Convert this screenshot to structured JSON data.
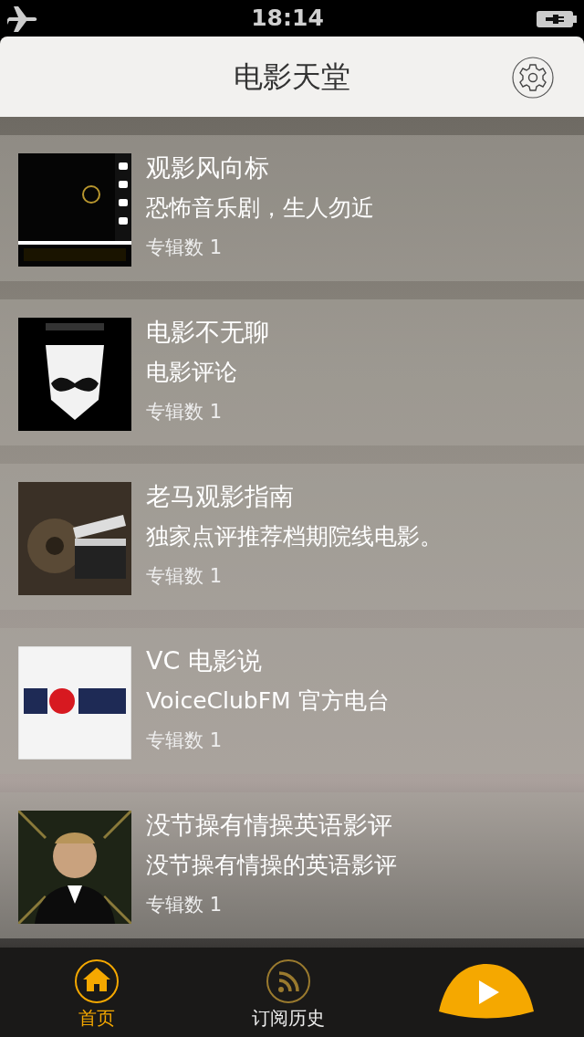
{
  "status_bar": {
    "time": "18:14"
  },
  "header": {
    "title": "电影天堂"
  },
  "channels": [
    {
      "title": "观影风向标",
      "description": "恐怖音乐剧，生人勿近",
      "album_count": "专辑数 1"
    },
    {
      "title": "电影不无聊",
      "description": "电影评论",
      "album_count": "专辑数 1"
    },
    {
      "title": "老马观影指南",
      "description": "独家点评推荐档期院线电影。",
      "album_count": "专辑数 1"
    },
    {
      "title": "VC 电影说",
      "description": "VoiceClubFM 官方电台",
      "album_count": "专辑数 1"
    },
    {
      "title": "没节操有情操英语影评",
      "description": "没节操有情操的英语影评",
      "album_count": "专辑数 1"
    }
  ],
  "tabs": [
    {
      "label": "首页",
      "kind": "home",
      "selected": true
    },
    {
      "label": "订阅历史",
      "kind": "rss",
      "selected": false
    }
  ]
}
